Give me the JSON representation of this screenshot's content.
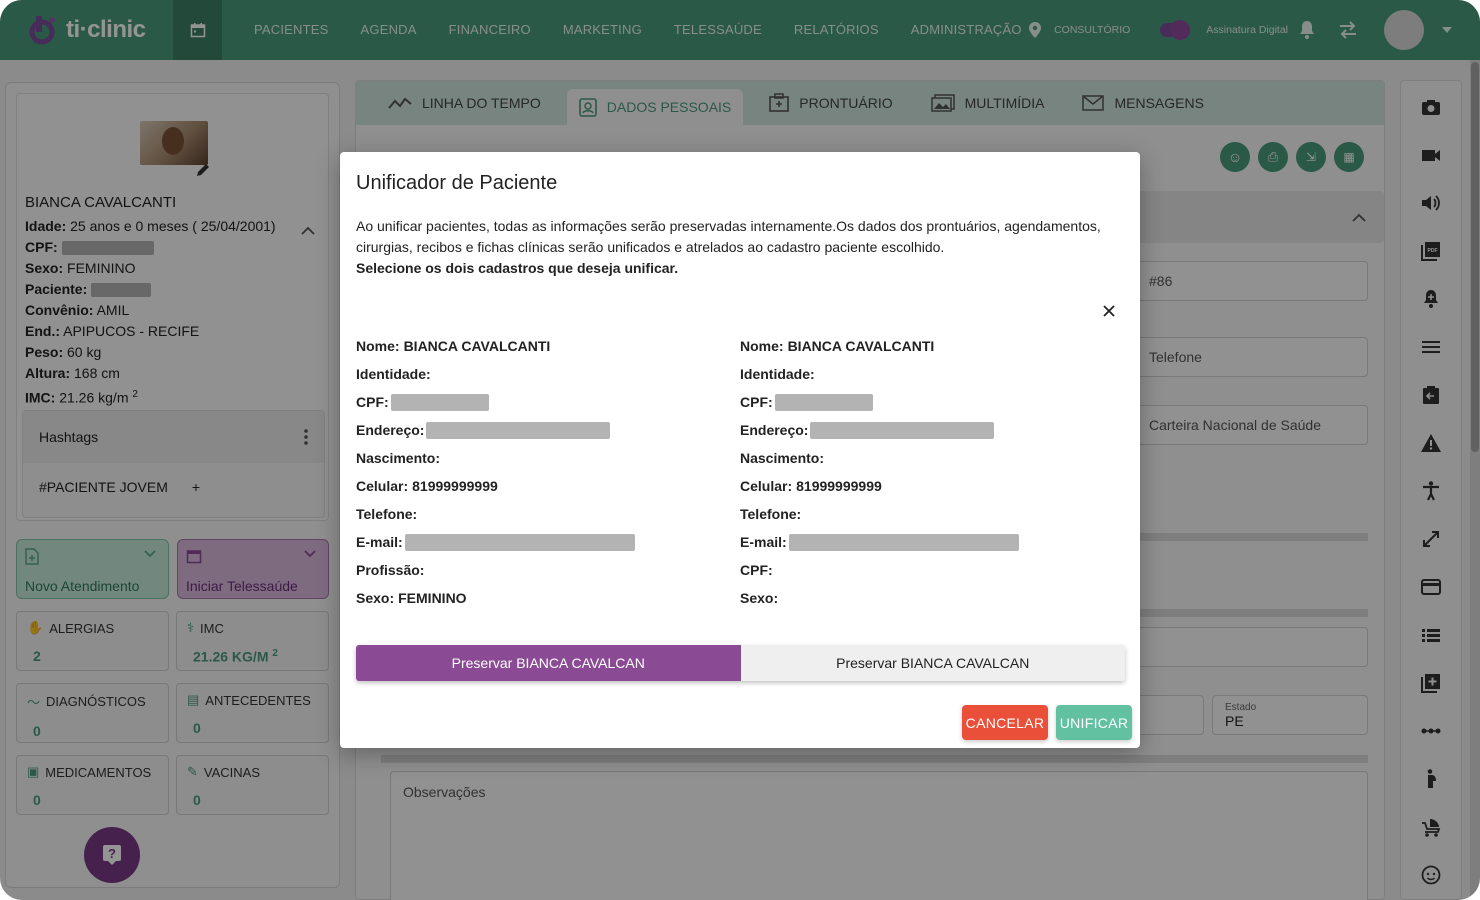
{
  "topbar": {
    "logo_text": "ti·clinic",
    "nav": [
      "PACIENTES",
      "AGENDA",
      "FINANCEIRO",
      "MARKETING",
      "TELESSAÚDE",
      "RELATÓRIOS",
      "ADMINISTRAÇÃO"
    ],
    "location_label": "CONSULTÓRIO",
    "signature_label": "Assinatura Digital"
  },
  "patient": {
    "name": "BIANCA CAVALCANTI",
    "rows": [
      {
        "label": "Idade:",
        "value": "25 anos e 0 meses ( 25/04/2001)"
      },
      {
        "label": "CPF:",
        "value": ""
      },
      {
        "label": "Sexo:",
        "value": "FEMININO"
      },
      {
        "label": "Paciente:",
        "value": ""
      },
      {
        "label": "Convênio:",
        "value": "AMIL"
      },
      {
        "label": "End.:",
        "value": "APIPUCOS -  RECIFE"
      },
      {
        "label": "Peso:",
        "value": "60 kg"
      },
      {
        "label": "Altura:",
        "value": "168 cm"
      },
      {
        "label": "IMC:",
        "value": "21.26 kg/m"
      }
    ],
    "imc_sup": "2"
  },
  "hashtags": {
    "title": "Hashtags",
    "tag": "#PACIENTE JOVEM",
    "add": "+"
  },
  "actions": {
    "new_visit": "Novo Atendimento",
    "telehealth": "Iniciar Telessaúde"
  },
  "stats": [
    {
      "title": "ALERGIAS",
      "value": "2"
    },
    {
      "title": "IMC",
      "value": "21.26 KG/M"
    },
    {
      "title": "DIAGNÓSTICOS",
      "value": "0"
    },
    {
      "title": "ANTECEDENTES",
      "value": "0"
    },
    {
      "title": "MEDICAMENTOS",
      "value": "0"
    },
    {
      "title": "VACINAS",
      "value": "0"
    }
  ],
  "stat_imc_sup": "2",
  "tabs": [
    "LINHA DO TEMPO",
    "DADOS PESSOAIS",
    "PRONTUÁRIO",
    "MULTIMÍDIA",
    "MENSAGENS"
  ],
  "form": {
    "id_value": "#86",
    "phone_placeholder": "Telefone",
    "card_placeholder": "Carteira Nacional de Saúde",
    "state_label": "Estado",
    "state_value": "PE",
    "notes_placeholder": "Observações"
  },
  "modal": {
    "title": "Unificador de Paciente",
    "desc": "Ao unificar pacientes, todas as informações serão preservadas internamente.Os dados dos prontuários, agendamentos, cirurgias, recibos e fichas clínicas serão unificados e atrelados ao cadastro paciente escolhido.",
    "instruction": "Selecione os dois cadastros que deseja unificar.",
    "left": [
      {
        "label": "Nome:",
        "value": "BIANCA CAVALCANTI"
      },
      {
        "label": "Identidade:",
        "value": ""
      },
      {
        "label": "CPF:",
        "value": ""
      },
      {
        "label": "Endereço:",
        "value": ""
      },
      {
        "label": "Nascimento:",
        "value": ""
      },
      {
        "label": "Celular:",
        "value": "81999999999"
      },
      {
        "label": "Telefone:",
        "value": ""
      },
      {
        "label": "E-mail:",
        "value": ""
      },
      {
        "label": "Profissão:",
        "value": ""
      },
      {
        "label": "Sexo:",
        "value": "FEMININO"
      }
    ],
    "right": [
      {
        "label": "Nome:",
        "value": "BIANCA CAVALCANTI"
      },
      {
        "label": "Identidade:",
        "value": ""
      },
      {
        "label": "CPF:",
        "value": ""
      },
      {
        "label": "Endereço:",
        "value": ""
      },
      {
        "label": "Nascimento:",
        "value": ""
      },
      {
        "label": "Celular:",
        "value": "81999999999"
      },
      {
        "label": "Telefone:",
        "value": ""
      },
      {
        "label": "E-mail:",
        "value": ""
      },
      {
        "label": "CPF:",
        "value": ""
      },
      {
        "label": "Sexo:",
        "value": ""
      }
    ],
    "preserve_a": "Preservar BIANCA CAVALCAN",
    "preserve_b": "Preservar BIANCA CAVALCAN",
    "cancel": "CANCELAR",
    "confirm": "UNIFICAR"
  },
  "colors": {
    "brand": "#4a9a7c",
    "purple": "#8a4a94",
    "cancel": "#ea4f3a",
    "confirm": "#62c1a0"
  }
}
